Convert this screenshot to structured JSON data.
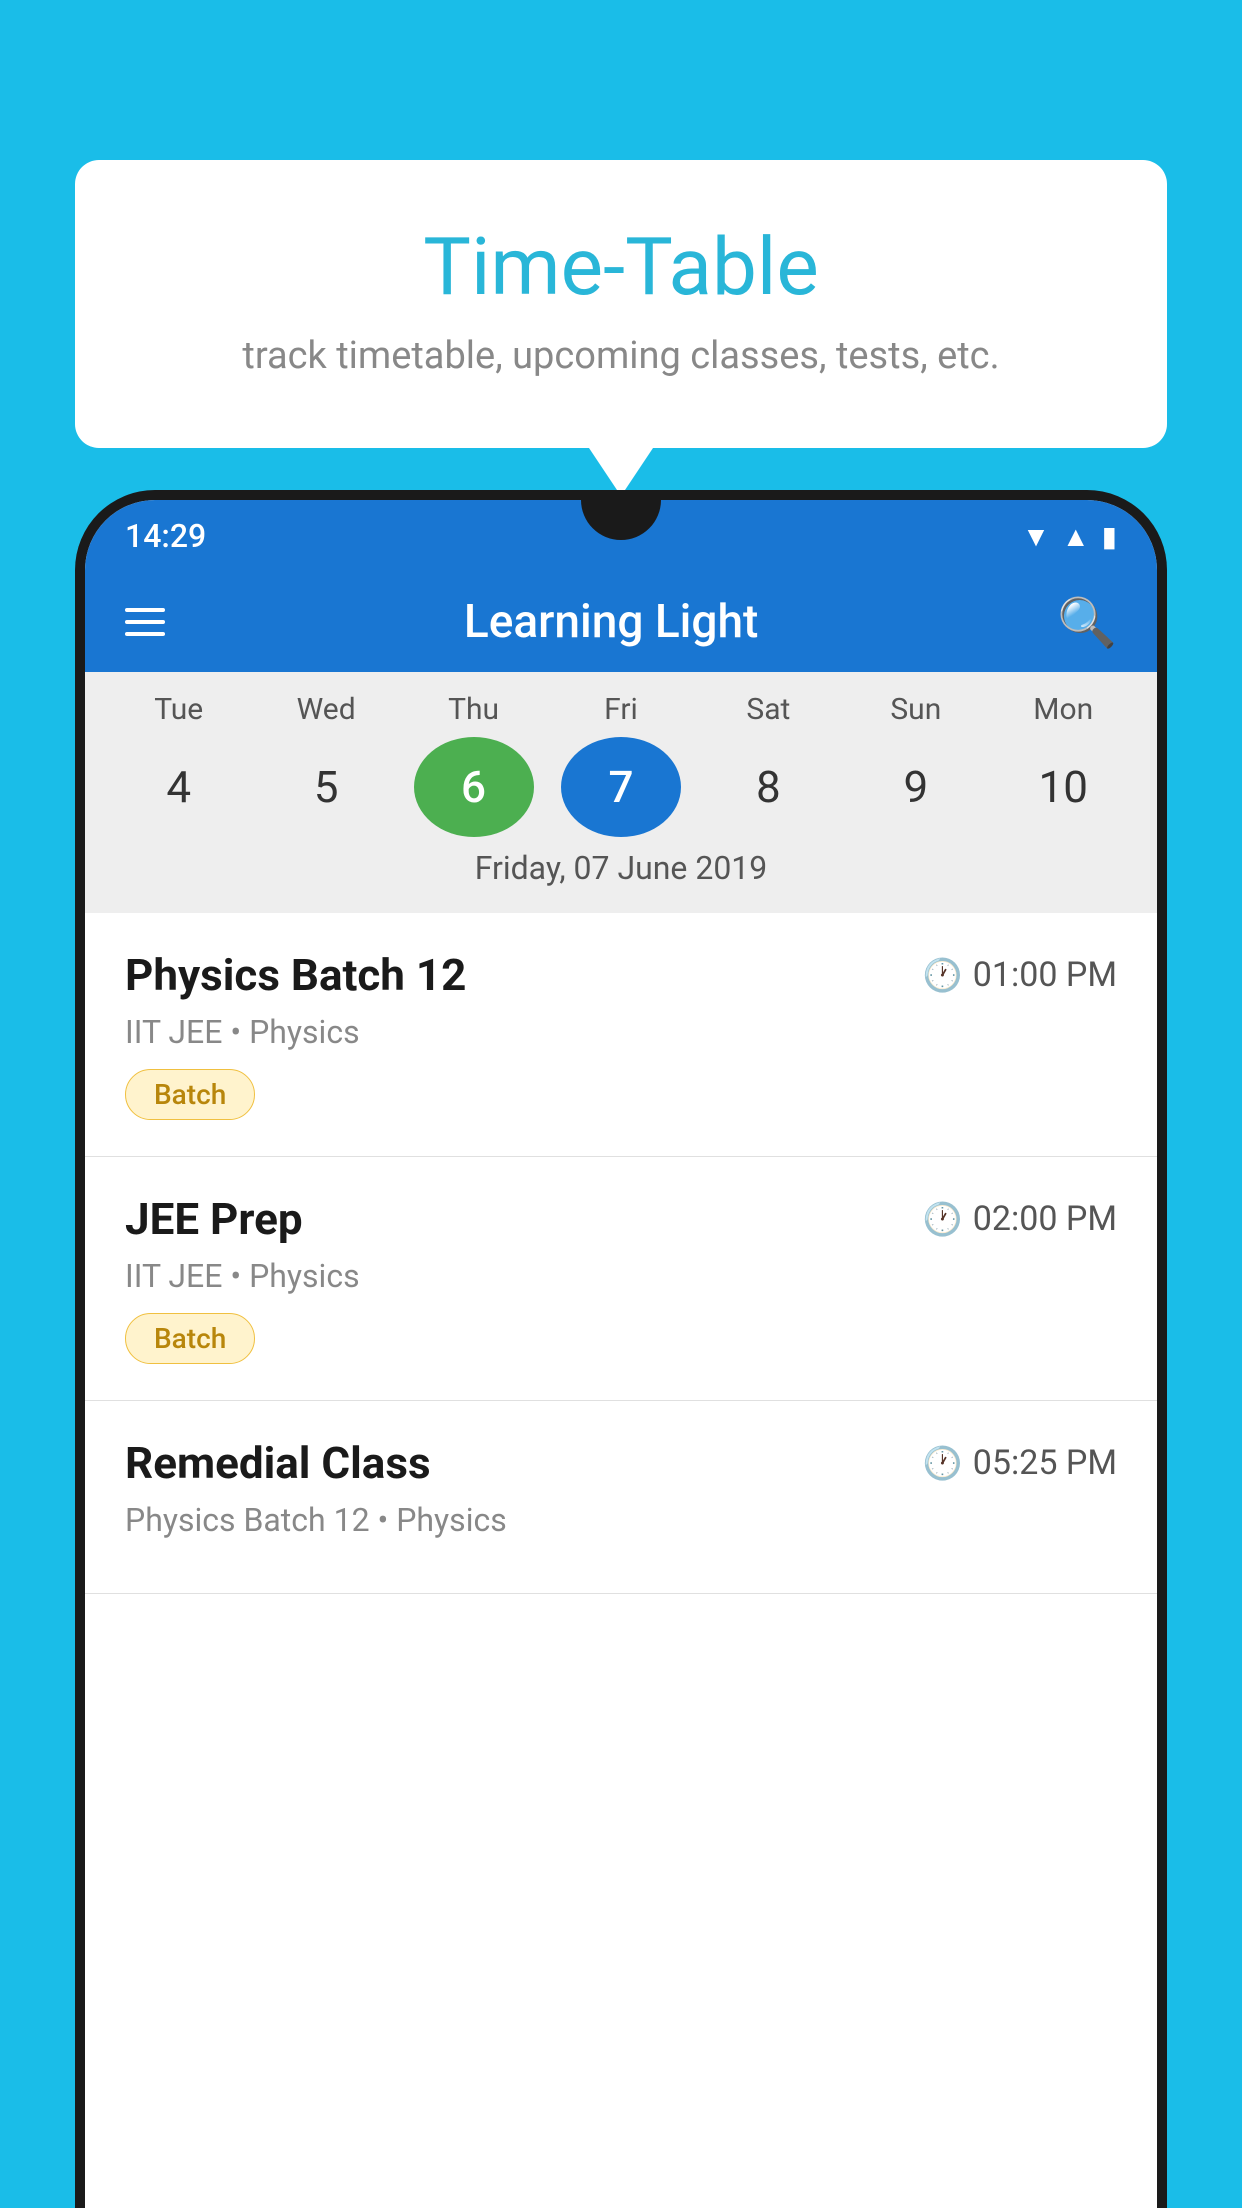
{
  "background_color": "#1ABDE8",
  "tooltip": {
    "title": "Time-Table",
    "subtitle": "track timetable, upcoming classes, tests, etc."
  },
  "phone": {
    "status_bar": {
      "time": "14:29"
    },
    "app_bar": {
      "title": "Learning Light"
    },
    "calendar": {
      "days": [
        {
          "label": "Tue",
          "number": "4",
          "state": "normal"
        },
        {
          "label": "Wed",
          "number": "5",
          "state": "normal"
        },
        {
          "label": "Thu",
          "number": "6",
          "state": "today"
        },
        {
          "label": "Fri",
          "number": "7",
          "state": "selected"
        },
        {
          "label": "Sat",
          "number": "8",
          "state": "normal"
        },
        {
          "label": "Sun",
          "number": "9",
          "state": "normal"
        },
        {
          "label": "Mon",
          "number": "10",
          "state": "normal"
        }
      ],
      "selected_date_label": "Friday, 07 June 2019"
    },
    "schedule": [
      {
        "title": "Physics Batch 12",
        "time": "01:00 PM",
        "subtitle": "IIT JEE • Physics",
        "badge": "Batch"
      },
      {
        "title": "JEE Prep",
        "time": "02:00 PM",
        "subtitle": "IIT JEE • Physics",
        "badge": "Batch"
      },
      {
        "title": "Remedial Class",
        "time": "05:25 PM",
        "subtitle": "Physics Batch 12 • Physics",
        "badge": null
      }
    ]
  }
}
